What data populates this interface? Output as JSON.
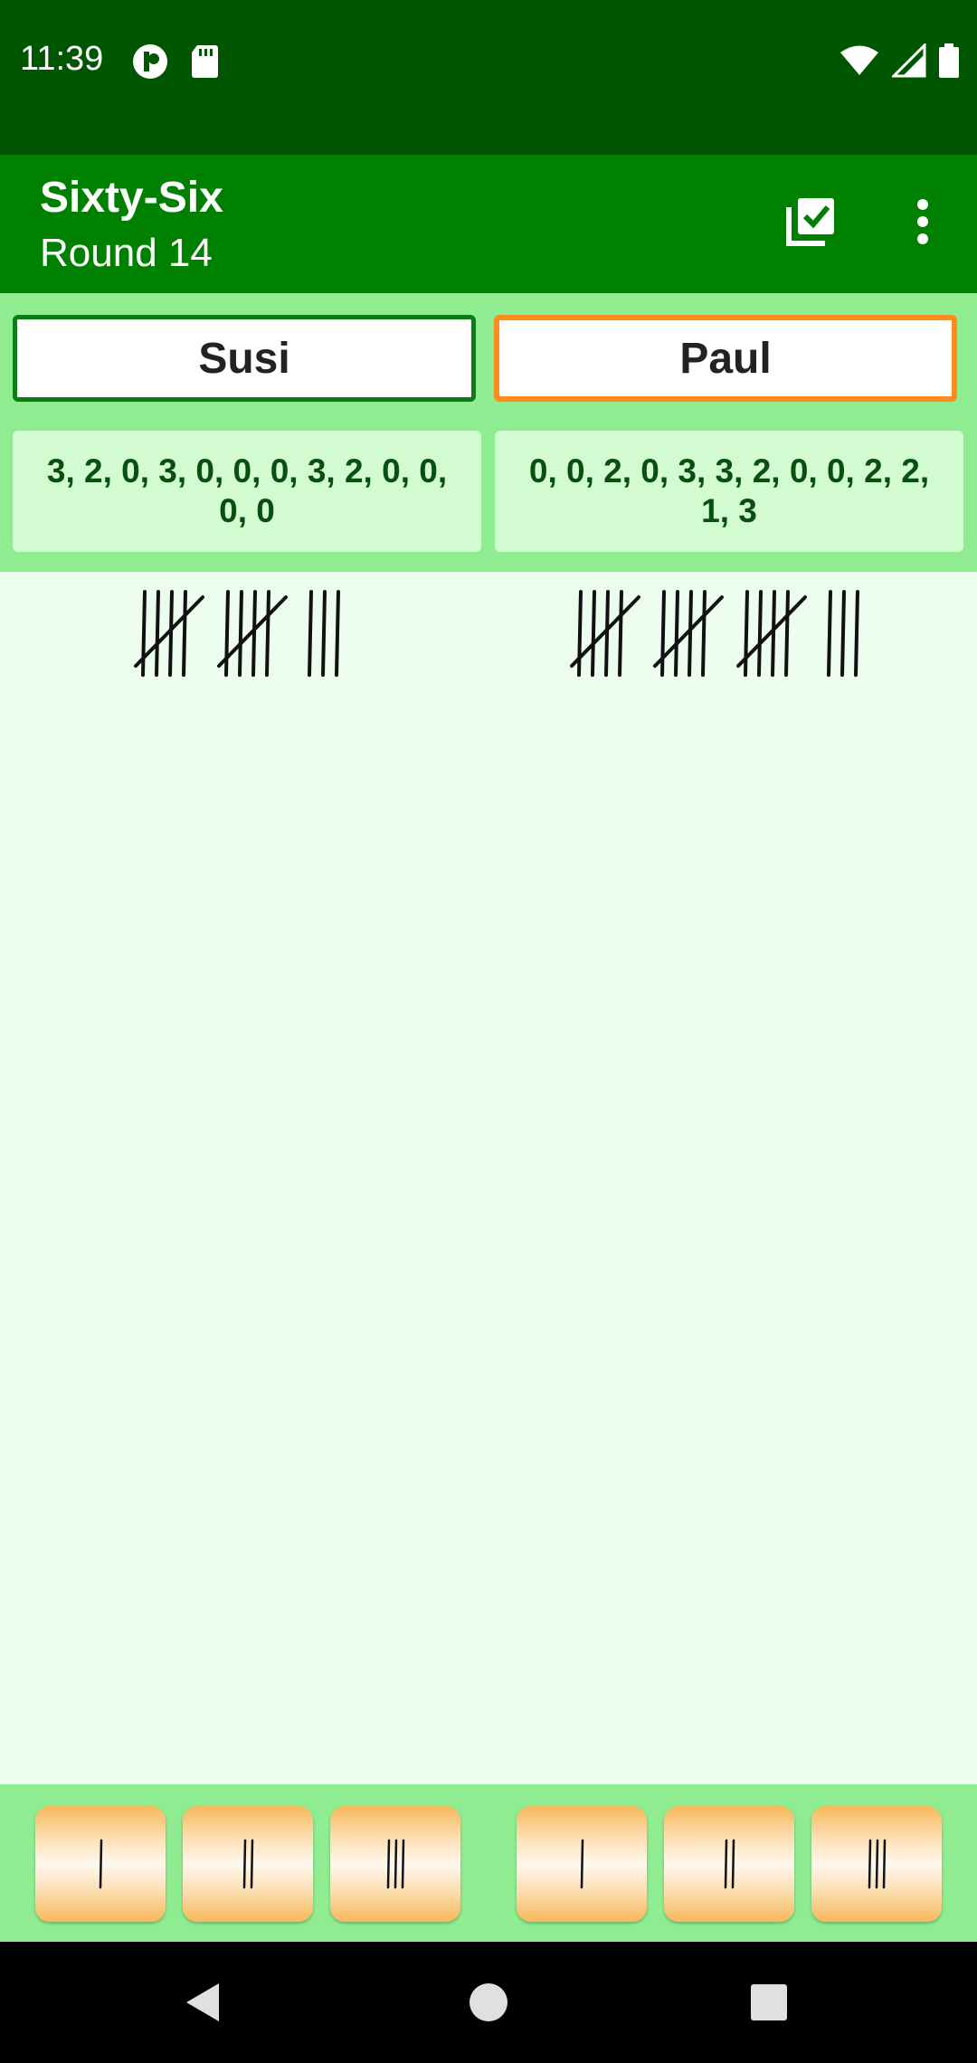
{
  "status_bar": {
    "time": "11:39"
  },
  "app_bar": {
    "title": "Sixty-Six",
    "subtitle": "Round 14",
    "icons": [
      "check-list-icon",
      "overflow-menu-icon"
    ]
  },
  "players": [
    {
      "name": "Susi",
      "rounds": "3, 2, 0, 3, 0, 0, 0, 3, 2, 0, 0, 0, 0",
      "total_tally": 13
    },
    {
      "name": "Paul",
      "rounds": "0, 0, 2, 0, 3, 3, 2, 0, 0, 2, 2, 1, 3",
      "total_tally": 18
    }
  ],
  "add_buttons": [
    {
      "player": "Susi",
      "value": 1
    },
    {
      "player": "Susi",
      "value": 2
    },
    {
      "player": "Susi",
      "value": 3
    },
    {
      "player": "Paul",
      "value": 1
    },
    {
      "player": "Paul",
      "value": 2
    },
    {
      "player": "Paul",
      "value": 3
    }
  ],
  "colors": {
    "status_bar": "#005500",
    "app_bar": "#008000",
    "players_area": "#90ec90",
    "score_box": "#d2fbd2",
    "content_bg": "#ecfdee",
    "active_player_border": "#ff8c1a",
    "inactive_player_border": "#0b7d14"
  }
}
